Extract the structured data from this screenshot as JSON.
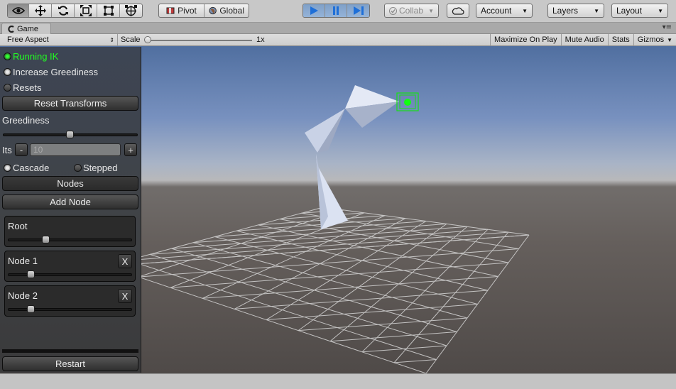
{
  "toolbar": {
    "pivot_label": "Pivot",
    "global_label": "Global",
    "collab_label": "Collab",
    "account_label": "Account",
    "layers_label": "Layers",
    "layout_label": "Layout"
  },
  "tab": {
    "title": "Game"
  },
  "game_bar": {
    "aspect": "Free Aspect",
    "scale_label": "Scale",
    "scale_value": "1x",
    "maximize_on_play": "Maximize On Play",
    "mute_audio": "Mute Audio",
    "stats": "Stats",
    "gizmos": "Gizmos"
  },
  "panel": {
    "running_ik": "Running IK",
    "increase_greediness": "Increase Greediness",
    "resets": "Resets",
    "reset_transforms": "Reset Transforms",
    "greediness_label": "Greediness",
    "greediness_value": 0.5,
    "its_label": "Its",
    "its_minus": "-",
    "its_value": "10",
    "its_plus": "+",
    "cascade": "Cascade",
    "stepped": "Stepped",
    "nodes_button": "Nodes",
    "add_node_button": "Add Node",
    "nodes": [
      {
        "name": "Root",
        "value": 0.32,
        "removable": false
      },
      {
        "name": "Node 1",
        "value": 0.2,
        "removable": true,
        "remove_label": "X"
      },
      {
        "name": "Node 2",
        "value": 0.2,
        "removable": true,
        "remove_label": "X"
      }
    ],
    "restart_button": "Restart"
  },
  "colors": {
    "accent_green": "#21ff21",
    "play_blue": "#1e6fd8"
  }
}
